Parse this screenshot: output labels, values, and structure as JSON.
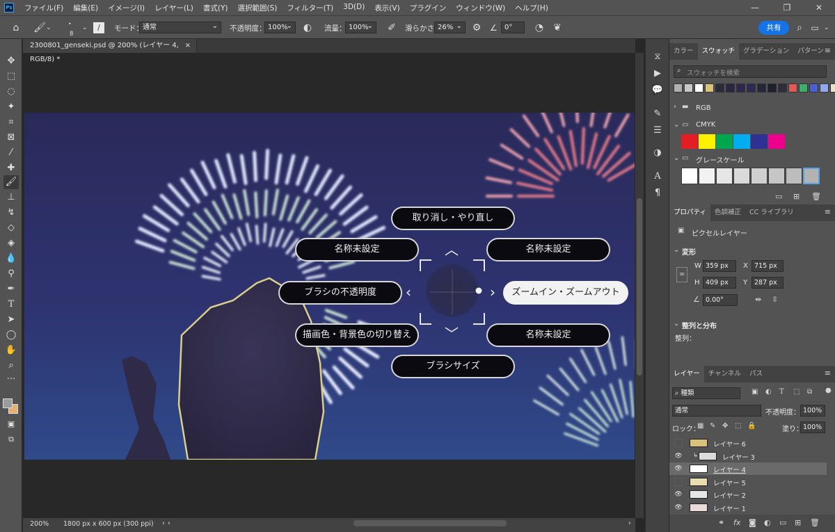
{
  "app": {
    "logo": "Ps"
  },
  "menu": [
    "ファイル(F)",
    "編集(E)",
    "イメージ(I)",
    "レイヤー(L)",
    "書式(Y)",
    "選択範囲(S)",
    "フィルター(T)",
    "3D(D)",
    "表示(V)",
    "プラグイン",
    "ウィンドウ(W)",
    "ヘルプ(H)"
  ],
  "window_controls": {
    "minimize": "—",
    "restore": "❐",
    "close": "✕"
  },
  "options": {
    "brush_size": "8",
    "mode_label": "モード：",
    "mode_value": "通常",
    "opacity_label": "不透明度：",
    "opacity_value": "100%",
    "flow_label": "流量：",
    "flow_value": "100%",
    "smoothing_label": "滑らかさ：",
    "smoothing_value": "26%",
    "angle_value": "0°",
    "share_label": "共有"
  },
  "document": {
    "tab_title": "2300801_genseki.psd @ 200% (レイヤー 4, RGB/8) *",
    "close": "×",
    "zoom": "200%",
    "info": "1800 px x 600 px (300 ppi)"
  },
  "pie_menu": {
    "top": "取り消し・やり直し",
    "top_left": "名称未設定",
    "top_right": "名称未設定",
    "left": "ブラシの不透明度",
    "right": "ズームイン・ズームアウト",
    "bottom_left": "描画色・背景色の切り替え",
    "bottom_right": "名称未設定",
    "bottom": "ブラシサイズ"
  },
  "swatches_panel": {
    "tabs": [
      "カラー",
      "スウォッチ",
      "グラデーション",
      "パターン"
    ],
    "active_tab": 1,
    "search_placeholder": "スウォッチを検索",
    "recent": [
      "#b0b0b0",
      "#c8c8c8",
      "#ffffff",
      "#d9c27a",
      "#2b2b3b",
      "#2a2540",
      "#30284a",
      "#2a2a55",
      "#26263a",
      "#1f1f2f",
      "#2c2c3c",
      "#e05a5a",
      "#3fae6a",
      "#4a5fd0",
      "#8fa8f0",
      "#e8e4c8"
    ],
    "groups": [
      {
        "name": "RGB"
      },
      {
        "name": "CMYK",
        "colors": [
          "#e31d23",
          "#fff200",
          "#00a54f",
          "#00aeef",
          "#2e3192",
          "#ec008c"
        ]
      },
      {
        "name": "グレースケール",
        "colors": [
          "#ffffff",
          "#f2f2f2",
          "#e6e6e6",
          "#dadada",
          "#d0d0d0",
          "#c6c6c6",
          "#bdbdbd",
          "#b3b3b3"
        ]
      }
    ]
  },
  "properties_panel": {
    "tabs": [
      "プロパティ",
      "色調補正",
      "CC ライブラリ"
    ],
    "active_tab": 0,
    "type_label": "ピクセルレイヤー",
    "transform_label": "変形",
    "w_label": "W",
    "w_value": "359 px",
    "h_label": "H",
    "h_value": "409 px",
    "x_label": "X",
    "x_value": "715 px",
    "y_label": "Y",
    "y_value": "287 px",
    "angle_value": "0.00°",
    "align_label": "整列と分布",
    "align_sub": "整列："
  },
  "layers_panel": {
    "tabs": [
      "レイヤー",
      "チャンネル",
      "パス"
    ],
    "active_tab": 0,
    "filter_value": "種類",
    "blend_value": "通常",
    "opacity_label": "不透明度：",
    "opacity_value": "100%",
    "lock_label": "ロック：",
    "fill_label": "塗り：",
    "fill_value": "100%",
    "layers": [
      {
        "name": "レイヤー 6",
        "visible": false,
        "thumb": "#d9c27a",
        "clip": false,
        "selected": false
      },
      {
        "name": "レイヤー 3",
        "visible": true,
        "thumb": "#dcdcdc",
        "clip": true,
        "selected": false
      },
      {
        "name": "レイヤー 4",
        "visible": true,
        "thumb": "#ffffff",
        "clip": false,
        "selected": true
      },
      {
        "name": "レイヤー 5",
        "visible": false,
        "thumb": "#e8dcb0",
        "clip": false,
        "selected": false
      },
      {
        "name": "レイヤー 2",
        "visible": true,
        "thumb": "#e6e6e6",
        "clip": false,
        "selected": false
      },
      {
        "name": "レイヤー 1",
        "visible": true,
        "thumb": "#eadbd8",
        "clip": false,
        "selected": false
      }
    ]
  },
  "colors": {
    "foreground": "#9a9a9a",
    "background": "#e8b070",
    "accent": "#1473e6"
  }
}
